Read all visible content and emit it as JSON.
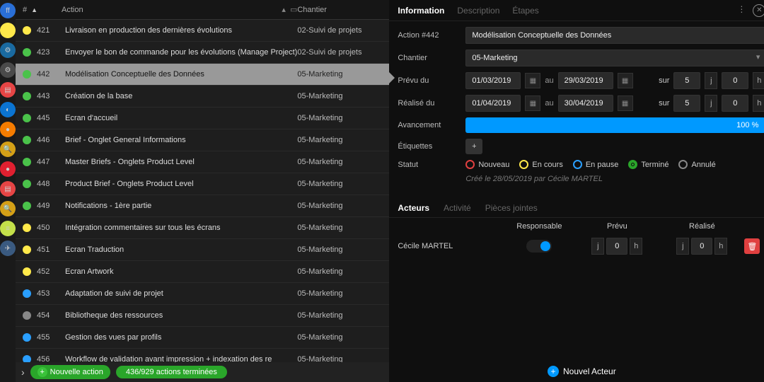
{
  "rail": {
    "items": [
      {
        "bg": "#2a6fd6",
        "txt": "ff"
      },
      {
        "bg": "#ffe94a",
        "txt": ""
      },
      {
        "bg": "#1a6aa0",
        "txt": "⚙"
      },
      {
        "bg": "#4a4a4a",
        "txt": "⚙"
      },
      {
        "bg": "#e64545",
        "txt": "▤"
      },
      {
        "bg": "#0b74d1",
        "txt": "◐"
      },
      {
        "bg": "#f57c00",
        "txt": "●"
      },
      {
        "bg": "#d4a017",
        "txt": "🔍"
      },
      {
        "bg": "#e02030",
        "txt": "●"
      },
      {
        "bg": "#e64545",
        "txt": "▤"
      },
      {
        "bg": "#d4a017",
        "txt": "🔍"
      },
      {
        "bg": "#c4e04a",
        "txt": "≡"
      },
      {
        "bg": "#3a5a80",
        "txt": "✈"
      }
    ]
  },
  "list": {
    "header": {
      "num": "#",
      "action": "Action",
      "chantier": "Chantier"
    },
    "rows": [
      {
        "c": "#ffe94a",
        "n": "421",
        "a": "Livraison en production des dernières évolutions",
        "ch": "02-Suivi de projets"
      },
      {
        "c": "#4ac24a",
        "n": "423",
        "a": "Envoyer le bon de commande pour les évolutions (Manage Project)",
        "ch": "02-Suivi de projets"
      },
      {
        "c": "#4ac24a",
        "n": "442",
        "a": "Modélisation Conceptuelle des Données",
        "ch": "05-Marketing",
        "sel": true
      },
      {
        "c": "#4ac24a",
        "n": "443",
        "a": "Création de la base",
        "ch": "05-Marketing"
      },
      {
        "c": "#4ac24a",
        "n": "445",
        "a": "Ecran d'accueil",
        "ch": "05-Marketing"
      },
      {
        "c": "#4ac24a",
        "n": "446",
        "a": "Brief - Onglet General Informations",
        "ch": "05-Marketing"
      },
      {
        "c": "#4ac24a",
        "n": "447",
        "a": "Master Briefs - Onglets Product Level",
        "ch": "05-Marketing"
      },
      {
        "c": "#4ac24a",
        "n": "448",
        "a": "Product Brief - Onglets Product Level",
        "ch": "05-Marketing"
      },
      {
        "c": "#4ac24a",
        "n": "449",
        "a": "Notifications - 1ère partie",
        "ch": "05-Marketing"
      },
      {
        "c": "#ffe94a",
        "n": "450",
        "a": "Intégration commentaires sur tous les écrans",
        "ch": "05-Marketing"
      },
      {
        "c": "#ffe94a",
        "n": "451",
        "a": "Ecran Traduction",
        "ch": "05-Marketing"
      },
      {
        "c": "#ffe94a",
        "n": "452",
        "a": "Ecran Artwork",
        "ch": "05-Marketing"
      },
      {
        "c": "#2a9fff",
        "n": "453",
        "a": "Adaptation de suivi de projet",
        "ch": "05-Marketing"
      },
      {
        "c": "#888",
        "n": "454",
        "a": "Bibliotheque des ressources",
        "ch": "05-Marketing"
      },
      {
        "c": "#2a9fff",
        "n": "455",
        "a": "Gestion des vues par profils",
        "ch": "05-Marketing"
      },
      {
        "c": "#2a9fff",
        "n": "456",
        "a": "Workflow de validation avant impression + indexation des re",
        "ch": "05-Marketing"
      }
    ],
    "footer": {
      "new": "Nouvelle action",
      "progress": "436/929 actions terminées"
    }
  },
  "detail": {
    "tabsTop": [
      "Information",
      "Description",
      "Étapes"
    ],
    "action_label": "Action #442",
    "action_val": "Modélisation Conceptuelle des Données",
    "chantier_label": "Chantier",
    "chantier_val": "05-Marketing",
    "prevu_label": "Prévu du",
    "prevu_from": "01/03/2019",
    "au": "au",
    "prevu_to": "29/03/2019",
    "sur": "sur",
    "d1": "5",
    "u1": "j",
    "d2": "0",
    "u2": "h",
    "realise_label": "Réalisé du",
    "realise_from": "01/04/2019",
    "realise_to": "30/04/2019",
    "r1": "5",
    "r2": "0",
    "avance_label": "Avancement",
    "avance_val": "100 %",
    "etiq_label": "Étiquettes",
    "statut_label": "Statut",
    "statuses": [
      {
        "label": "Nouveau",
        "color": "#e04040"
      },
      {
        "label": "En cours",
        "color": "#ffe94a"
      },
      {
        "label": "En pause",
        "color": "#2a9fff"
      },
      {
        "label": "Terminé",
        "color": "#2aa62a",
        "checked": true
      },
      {
        "label": "Annulé",
        "color": "#888"
      }
    ],
    "meta": "Créé le 28/05/2019 par Cécile MARTEL",
    "tabsMid": [
      "Acteurs",
      "Activité",
      "Pièces jointes"
    ],
    "actorHead": {
      "resp": "Responsable",
      "prevu": "Prévu",
      "realise": "Réalisé"
    },
    "actor": {
      "name": "Cécile MARTEL",
      "pj": "j",
      "pv": "0",
      "ph": "h",
      "rj": "j",
      "rv": "0",
      "rh": "h"
    },
    "footer": "Nouvel Acteur"
  }
}
